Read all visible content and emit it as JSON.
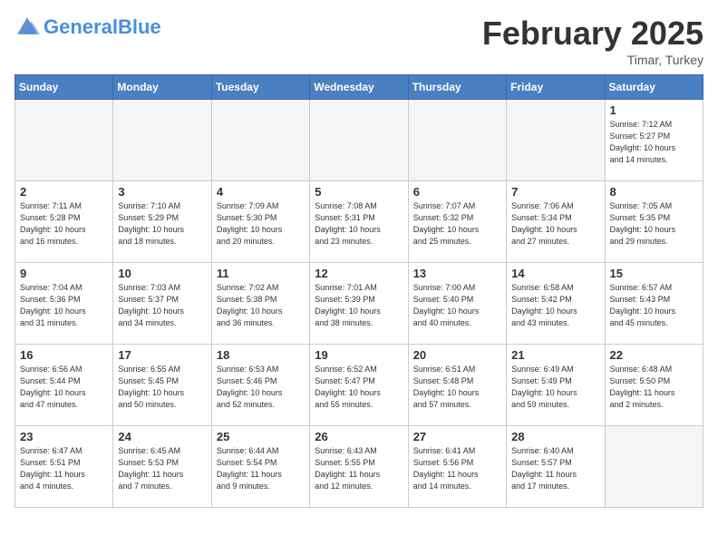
{
  "header": {
    "logo_general": "General",
    "logo_blue": "Blue",
    "month": "February 2025",
    "location": "Timar, Turkey"
  },
  "weekdays": [
    "Sunday",
    "Monday",
    "Tuesday",
    "Wednesday",
    "Thursday",
    "Friday",
    "Saturday"
  ],
  "weeks": [
    [
      {
        "day": "",
        "info": ""
      },
      {
        "day": "",
        "info": ""
      },
      {
        "day": "",
        "info": ""
      },
      {
        "day": "",
        "info": ""
      },
      {
        "day": "",
        "info": ""
      },
      {
        "day": "",
        "info": ""
      },
      {
        "day": "1",
        "info": "Sunrise: 7:12 AM\nSunset: 5:27 PM\nDaylight: 10 hours\nand 14 minutes."
      }
    ],
    [
      {
        "day": "2",
        "info": "Sunrise: 7:11 AM\nSunset: 5:28 PM\nDaylight: 10 hours\nand 16 minutes."
      },
      {
        "day": "3",
        "info": "Sunrise: 7:10 AM\nSunset: 5:29 PM\nDaylight: 10 hours\nand 18 minutes."
      },
      {
        "day": "4",
        "info": "Sunrise: 7:09 AM\nSunset: 5:30 PM\nDaylight: 10 hours\nand 20 minutes."
      },
      {
        "day": "5",
        "info": "Sunrise: 7:08 AM\nSunset: 5:31 PM\nDaylight: 10 hours\nand 23 minutes."
      },
      {
        "day": "6",
        "info": "Sunrise: 7:07 AM\nSunset: 5:32 PM\nDaylight: 10 hours\nand 25 minutes."
      },
      {
        "day": "7",
        "info": "Sunrise: 7:06 AM\nSunset: 5:34 PM\nDaylight: 10 hours\nand 27 minutes."
      },
      {
        "day": "8",
        "info": "Sunrise: 7:05 AM\nSunset: 5:35 PM\nDaylight: 10 hours\nand 29 minutes."
      }
    ],
    [
      {
        "day": "9",
        "info": "Sunrise: 7:04 AM\nSunset: 5:36 PM\nDaylight: 10 hours\nand 31 minutes."
      },
      {
        "day": "10",
        "info": "Sunrise: 7:03 AM\nSunset: 5:37 PM\nDaylight: 10 hours\nand 34 minutes."
      },
      {
        "day": "11",
        "info": "Sunrise: 7:02 AM\nSunset: 5:38 PM\nDaylight: 10 hours\nand 36 minutes."
      },
      {
        "day": "12",
        "info": "Sunrise: 7:01 AM\nSunset: 5:39 PM\nDaylight: 10 hours\nand 38 minutes."
      },
      {
        "day": "13",
        "info": "Sunrise: 7:00 AM\nSunset: 5:40 PM\nDaylight: 10 hours\nand 40 minutes."
      },
      {
        "day": "14",
        "info": "Sunrise: 6:58 AM\nSunset: 5:42 PM\nDaylight: 10 hours\nand 43 minutes."
      },
      {
        "day": "15",
        "info": "Sunrise: 6:57 AM\nSunset: 5:43 PM\nDaylight: 10 hours\nand 45 minutes."
      }
    ],
    [
      {
        "day": "16",
        "info": "Sunrise: 6:56 AM\nSunset: 5:44 PM\nDaylight: 10 hours\nand 47 minutes."
      },
      {
        "day": "17",
        "info": "Sunrise: 6:55 AM\nSunset: 5:45 PM\nDaylight: 10 hours\nand 50 minutes."
      },
      {
        "day": "18",
        "info": "Sunrise: 6:53 AM\nSunset: 5:46 PM\nDaylight: 10 hours\nand 52 minutes."
      },
      {
        "day": "19",
        "info": "Sunrise: 6:52 AM\nSunset: 5:47 PM\nDaylight: 10 hours\nand 55 minutes."
      },
      {
        "day": "20",
        "info": "Sunrise: 6:51 AM\nSunset: 5:48 PM\nDaylight: 10 hours\nand 57 minutes."
      },
      {
        "day": "21",
        "info": "Sunrise: 6:49 AM\nSunset: 5:49 PM\nDaylight: 10 hours\nand 59 minutes."
      },
      {
        "day": "22",
        "info": "Sunrise: 6:48 AM\nSunset: 5:50 PM\nDaylight: 11 hours\nand 2 minutes."
      }
    ],
    [
      {
        "day": "23",
        "info": "Sunrise: 6:47 AM\nSunset: 5:51 PM\nDaylight: 11 hours\nand 4 minutes."
      },
      {
        "day": "24",
        "info": "Sunrise: 6:45 AM\nSunset: 5:53 PM\nDaylight: 11 hours\nand 7 minutes."
      },
      {
        "day": "25",
        "info": "Sunrise: 6:44 AM\nSunset: 5:54 PM\nDaylight: 11 hours\nand 9 minutes."
      },
      {
        "day": "26",
        "info": "Sunrise: 6:43 AM\nSunset: 5:55 PM\nDaylight: 11 hours\nand 12 minutes."
      },
      {
        "day": "27",
        "info": "Sunrise: 6:41 AM\nSunset: 5:56 PM\nDaylight: 11 hours\nand 14 minutes."
      },
      {
        "day": "28",
        "info": "Sunrise: 6:40 AM\nSunset: 5:57 PM\nDaylight: 11 hours\nand 17 minutes."
      },
      {
        "day": "",
        "info": ""
      }
    ]
  ]
}
